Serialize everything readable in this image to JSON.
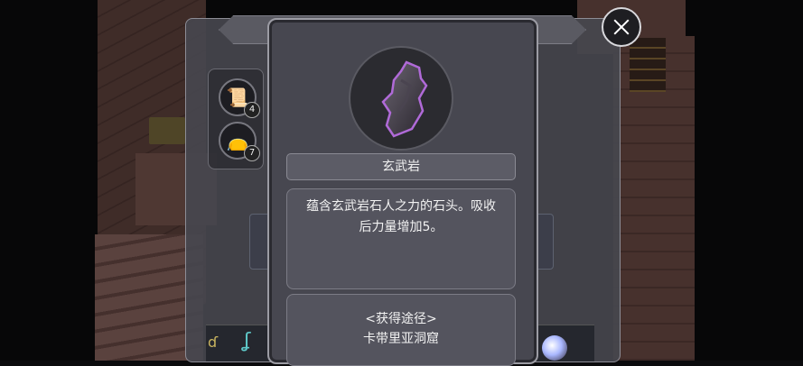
{
  "background_panel": {
    "title": "",
    "tabs": [
      {
        "name": "scroll-book-icon",
        "count": "4"
      },
      {
        "name": "pouch-icon",
        "count": "7"
      }
    ]
  },
  "close_button": {
    "icon": "close-icon"
  },
  "item_popup": {
    "icon": "obsidian-stone-icon",
    "name": "玄武岩",
    "description": "蕴含玄武岩石人之力的石头。吸收后力量增加5。",
    "source_heading": "<获得途径>",
    "source_location": "卡带里亚洞窟"
  },
  "colors": {
    "panel": "#474750",
    "panel_border": "#9c9ca4",
    "text": "#f2f2f2",
    "stone_glow": "#b06ad8"
  }
}
